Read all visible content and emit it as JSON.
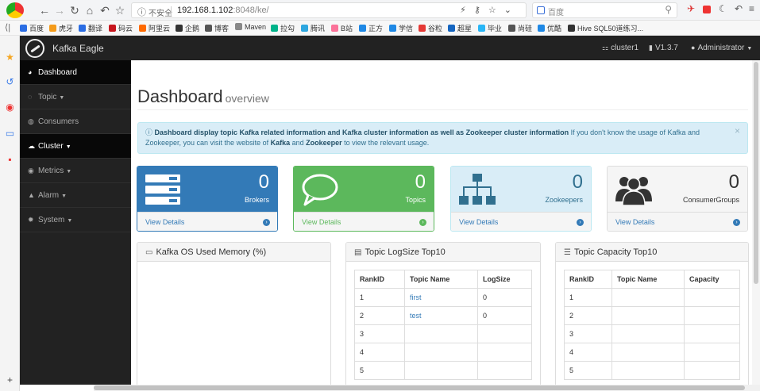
{
  "browser": {
    "security_label": "不安全",
    "url_host": "192.168.1.102",
    "url_rest": ":8048/ke/",
    "search_placeholder": "百度"
  },
  "bookmarks": [
    {
      "label": "百度",
      "color": "#2b6de3"
    },
    {
      "label": "虎牙",
      "color": "#f49b1a"
    },
    {
      "label": "翻译",
      "color": "#2b6de3"
    },
    {
      "label": "码云",
      "color": "#c7161d"
    },
    {
      "label": "阿里云",
      "color": "#ff6a00"
    },
    {
      "label": "企鹅",
      "color": "#333333"
    },
    {
      "label": "博客",
      "color": "#555555"
    },
    {
      "label": "Maven",
      "color": "#888888"
    },
    {
      "label": "拉勾",
      "color": "#00b38a"
    },
    {
      "label": "腾讯",
      "color": "#2ea7e0"
    },
    {
      "label": "B站",
      "color": "#fb7299"
    },
    {
      "label": "正方",
      "color": "#1e88e5"
    },
    {
      "label": "学信",
      "color": "#1e88e5"
    },
    {
      "label": "谷粒",
      "color": "#e53935"
    },
    {
      "label": "超星",
      "color": "#1565c0"
    },
    {
      "label": "毕业",
      "color": "#29b6f6"
    },
    {
      "label": "尚硅",
      "color": "#555555"
    },
    {
      "label": "优酷",
      "color": "#1e88e5"
    },
    {
      "label": "Hive SQL50道练习...",
      "color": "#333333"
    }
  ],
  "app": {
    "brand": "Kafka Eagle",
    "cluster": "cluster1",
    "version": "V1.3.7",
    "user": "Administrator"
  },
  "sidebar": [
    {
      "label": "Dashboard",
      "glyph": "dashboard-icon",
      "active": true,
      "caret": false
    },
    {
      "label": "Topic",
      "glyph": "comment-icon",
      "active": false,
      "caret": true
    },
    {
      "label": "Consumers",
      "glyph": "users-icon",
      "active": false,
      "caret": false
    },
    {
      "label": "Cluster",
      "glyph": "cloud-icon",
      "active": true,
      "caret": true
    },
    {
      "label": "Metrics",
      "glyph": "eye-icon",
      "active": false,
      "caret": true
    },
    {
      "label": "Alarm",
      "glyph": "bell-icon",
      "active": false,
      "caret": true
    },
    {
      "label": "System",
      "glyph": "gear-icon",
      "active": false,
      "caret": true
    }
  ],
  "header": {
    "title": "Dashboard",
    "subtitle": "overview"
  },
  "alert": {
    "bold": "Dashboard display topic Kafka related information and Kafka cluster information as well as Zookeeper cluster information",
    "text1": " If you don't know the usage of Kafka and Zookeeper, you can visit the website of ",
    "kafka": "Kafka",
    "and": " and ",
    "zookeeper": "Zookeeper",
    "text2": " to view the relevant usage.",
    "close": "×"
  },
  "cards": [
    {
      "count": "0",
      "label": "Brokers",
      "link": "View Details",
      "color": "#337ab7"
    },
    {
      "count": "0",
      "label": "Topics",
      "link": "View Details",
      "color": "#5cb85c"
    },
    {
      "count": "0",
      "label": "Zookeepers",
      "link": "View Details",
      "color": "#337ab7"
    },
    {
      "count": "0",
      "label": "ConsumerGroups",
      "link": "View Details",
      "color": "#337ab7"
    }
  ],
  "panels": {
    "memory": {
      "title": "Kafka OS Used Memory (%)"
    },
    "logsize": {
      "title": "Topic LogSize Top10",
      "headers": [
        "RankID",
        "Topic Name",
        "LogSize"
      ],
      "rows": [
        [
          "1",
          "first",
          "0"
        ],
        [
          "2",
          "test",
          "0"
        ],
        [
          "3",
          "",
          ""
        ],
        [
          "4",
          "",
          ""
        ],
        [
          "5",
          "",
          ""
        ]
      ]
    },
    "capacity": {
      "title": "Topic Capacity Top10",
      "headers": [
        "RankID",
        "Topic Name",
        "Capacity"
      ],
      "rows": [
        [
          "1",
          "",
          ""
        ],
        [
          "2",
          "",
          ""
        ],
        [
          "3",
          "",
          ""
        ],
        [
          "4",
          "",
          ""
        ],
        [
          "5",
          "",
          ""
        ]
      ]
    }
  }
}
